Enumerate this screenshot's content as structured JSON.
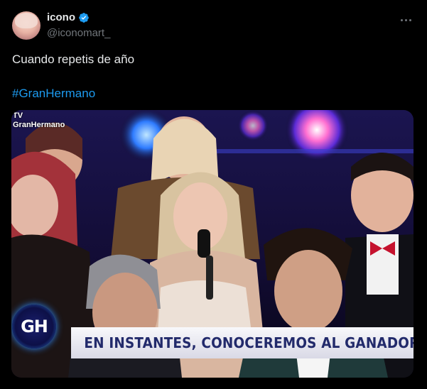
{
  "author": {
    "display_name": "icono",
    "handle": "@iconomart_",
    "verified": true
  },
  "tweet": {
    "text": "Cuando repetis de año",
    "hashtag": "#GranHermano"
  },
  "media": {
    "channel_label_line1": "TV",
    "channel_label_line2": "GranHermano",
    "logo_text": "GH",
    "ticker_text": "EN INSTANTES, CONOCEREMOS AL GANADOR DEL CICLO"
  },
  "colors": {
    "background": "#000000",
    "text": "#e7e9ea",
    "muted": "#71767b",
    "link": "#1d9bf0",
    "ticker_text": "#222a6b"
  },
  "icons": {
    "verified": "verified-badge-icon",
    "more": "more-options-icon"
  }
}
